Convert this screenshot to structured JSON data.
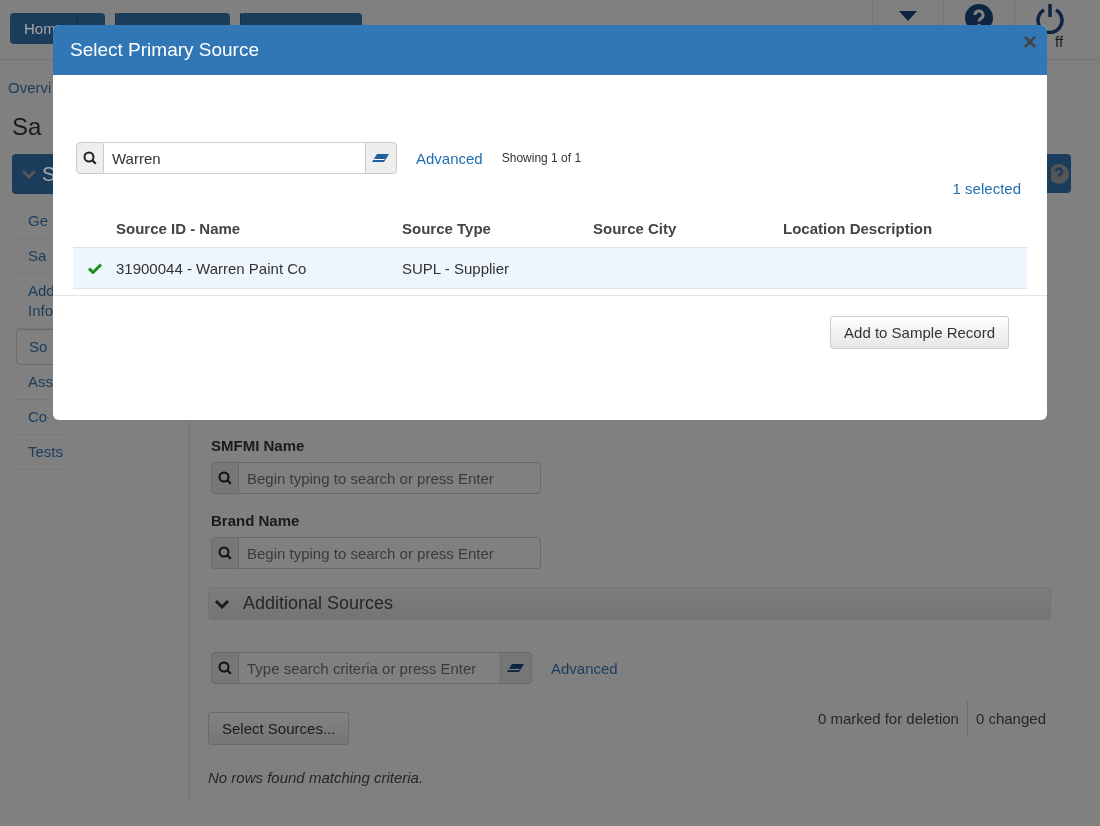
{
  "nav": {
    "first_label": "Hom",
    "logoff_label": "ff"
  },
  "breadcrumb": "Overvi",
  "page_title": "Sa",
  "section_header": {
    "label": "S",
    "expanded": true
  },
  "sidebar": [
    {
      "label": "Ge",
      "selected": false
    },
    {
      "label": "Sa",
      "selected": false
    },
    {
      "label": "Add Info",
      "selected": false
    },
    {
      "label": "So",
      "selected": true
    },
    {
      "label": "Ass",
      "selected": false
    },
    {
      "label": "Co",
      "selected": false
    },
    {
      "label": "Tests",
      "selected": false
    }
  ],
  "main": {
    "fields": [
      {
        "label": "SMFMI Name",
        "placeholder": "Begin typing to search or press Enter"
      },
      {
        "label": "Brand Name",
        "placeholder": "Begin typing to search or press Enter"
      }
    ],
    "additional_sources": {
      "title": "Additional Sources",
      "expanded": true,
      "search_placeholder": "Type search criteria or press Enter",
      "advanced_link": "Advanced",
      "select_button": "Select Sources...",
      "marked": "0 marked for deletion",
      "changed": "0 changed",
      "empty_message": "No rows found matching criteria."
    }
  },
  "modal": {
    "title": "Select Primary Source",
    "close": "×",
    "search_value": "Warren",
    "advanced_link": "Advanced",
    "showing": "Showing 1 of 1",
    "selected_count": "1 selected",
    "columns": [
      "Source ID - Name",
      "Source Type",
      "Source City",
      "Location Description"
    ],
    "rows": [
      {
        "selected": true,
        "id_name": "31900044 - Warren Paint Co",
        "type": "SUPL - Supplier"
      }
    ],
    "add_button": "Add to Sample Record"
  }
}
